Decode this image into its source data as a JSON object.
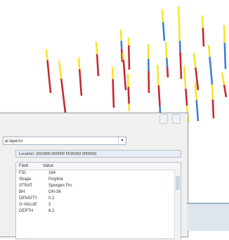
{
  "identify": {
    "layer_select_value": "al layers>",
    "location_label": "Location:",
    "location_value": "(652965.000000 5535392.000000)",
    "columns": [
      "Field",
      "Value"
    ],
    "rows": [
      {
        "field": "FID",
        "value": "164"
      },
      {
        "field": "Shape",
        "value": "Polyline"
      },
      {
        "field": "STRAT",
        "value": "Spergen Fm."
      },
      {
        "field": "BH",
        "value": "OH-36"
      },
      {
        "field": "DENSITY",
        "value": "0.2"
      },
      {
        "field": "G-VALUE",
        "value": "2"
      },
      {
        "field": "DEPTH",
        "value": "8.2"
      }
    ]
  },
  "colors": {
    "background": "#ffffff",
    "yellow": "#f5e52a",
    "red": "#c62a2e",
    "blue": "#3f7fdd"
  }
}
